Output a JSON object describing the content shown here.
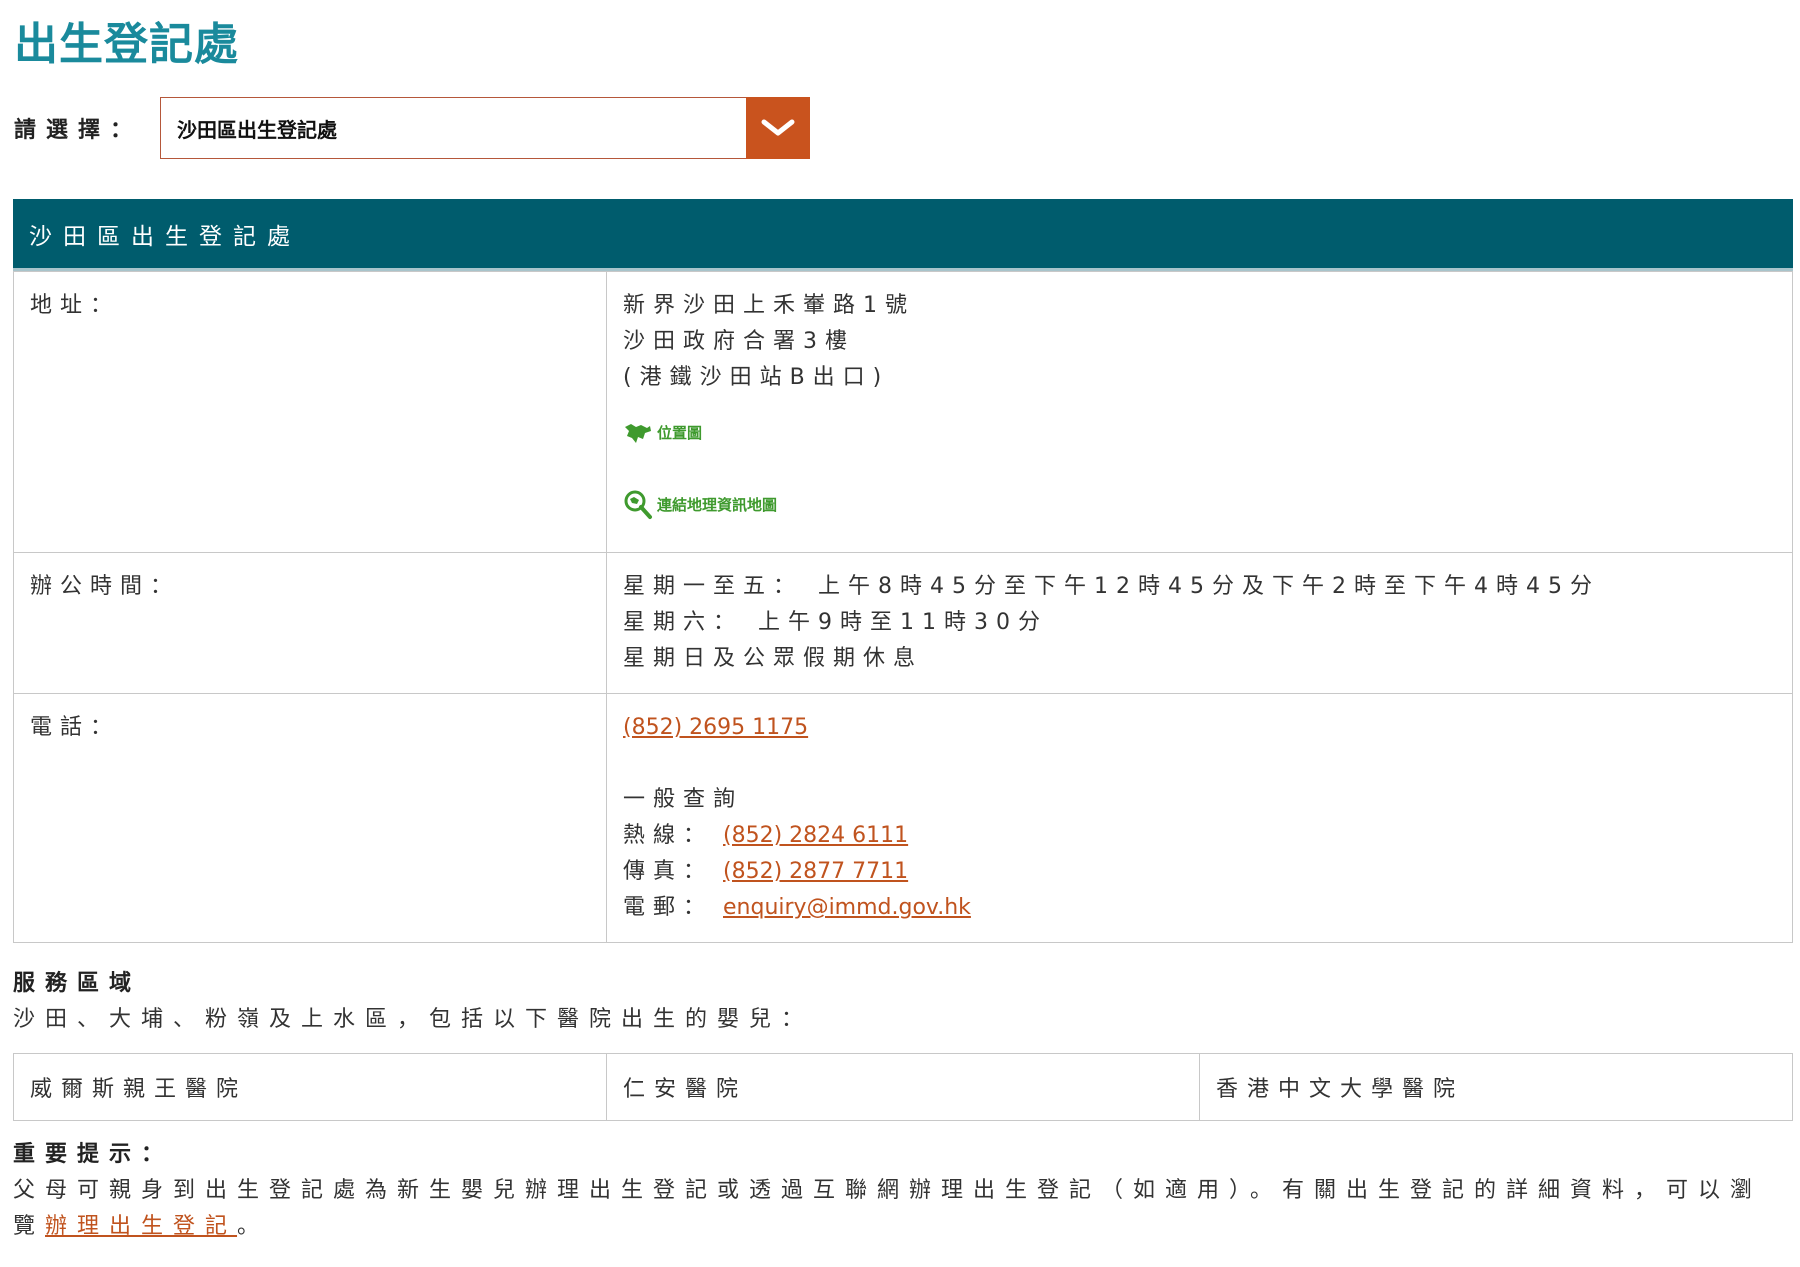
{
  "page": {
    "title": "出生登記處"
  },
  "selector": {
    "label": "請選擇：",
    "selected": "沙田區出生登記處"
  },
  "office": {
    "name": "沙田區出生登記處",
    "address": {
      "label": "地址：",
      "lines": [
        "新界沙田上禾輋路1號",
        "沙田政府合署3樓",
        "(港鐵沙田站B出口)"
      ],
      "location_map_label": "位置圖",
      "geoinfo_map_label": "連結地理資訊地圖"
    },
    "hours": {
      "label": "辦公時間：",
      "lines": [
        "星期一至五： 上午8時45分至下午12時45分及下午2時至下午4時45分",
        "星期六： 上午9時至11時30分",
        "星期日及公眾假期休息"
      ]
    },
    "phone": {
      "label": "電話：",
      "number": "(852) 2695 1175",
      "enquiry_title": "一般查詢",
      "hotline_label": "熱線：",
      "hotline": "(852) 2824 6111",
      "fax_label": "傳真：",
      "fax": "(852) 2877 7711",
      "email_label": "電郵：",
      "email": "enquiry@immd.gov.hk"
    }
  },
  "service_area": {
    "title": "服務區域",
    "description": "沙田、大埔、粉嶺及上水區，包括以下醫院出生的嬰兒：",
    "hospitals": [
      "威爾斯親王醫院",
      "仁安醫院",
      "香港中文大學醫院"
    ]
  },
  "notice": {
    "title": "重要提示：",
    "text": "父母可親身到出生登記處為新生嬰兒辦理出生登記或透過互聯網辦理出生登記（如適用）。有關出生登記的詳細資料，可以瀏覽",
    "link_text": "辦理出生登記",
    "suffix": "。"
  },
  "colors": {
    "title": "#1a8a9c",
    "header_bg": "#005c6d",
    "accent": "#c9531e",
    "link": "#c0531e",
    "map_icon": "#3f9a2e"
  },
  "icons": {
    "dropdown": "chevron-down-icon",
    "location_map": "map-region-icon",
    "geoinfo_map": "magnifier-map-icon"
  }
}
